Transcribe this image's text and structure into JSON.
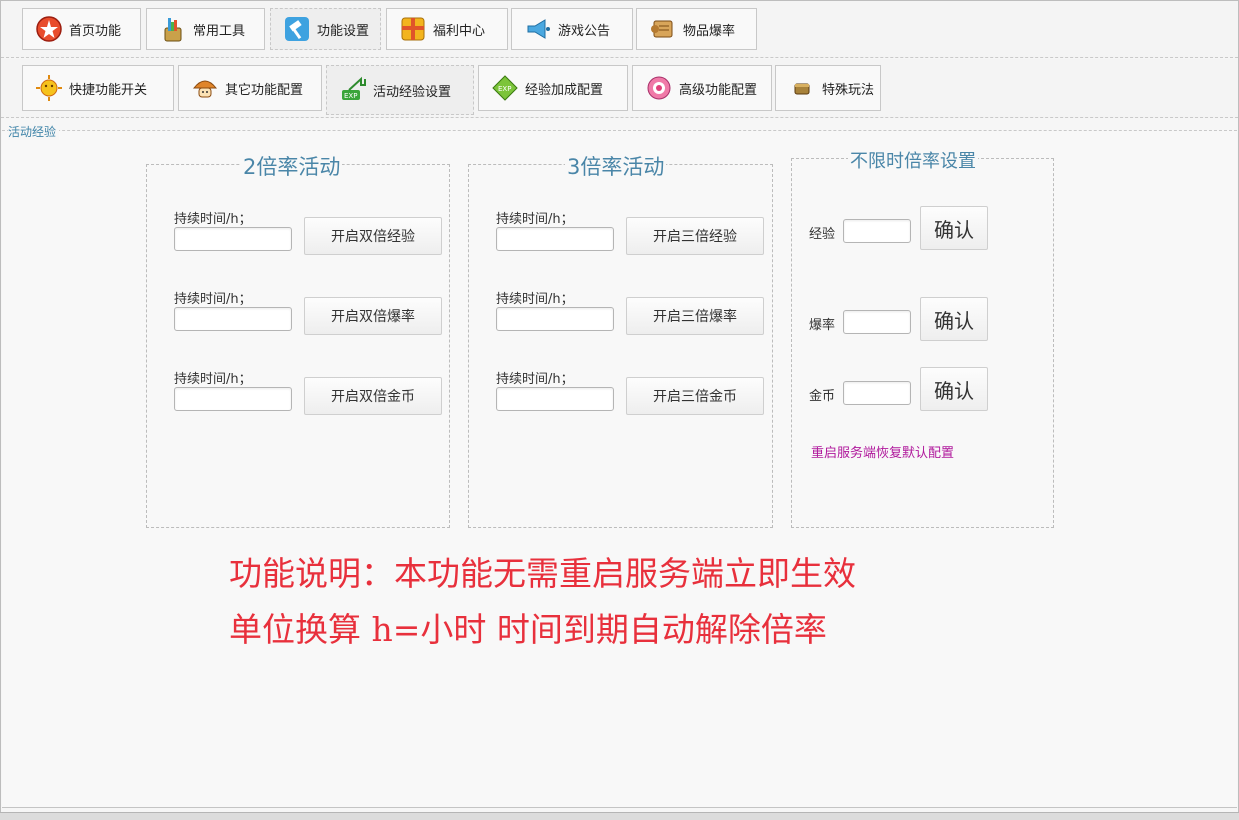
{
  "top_tabs": [
    {
      "label": "首页功能",
      "icon": "red-star-icon"
    },
    {
      "label": "常用工具",
      "icon": "tools-icon"
    },
    {
      "label": "功能设置",
      "icon": "hammer-icon"
    },
    {
      "label": "福利中心",
      "icon": "gift-box-icon"
    },
    {
      "label": "游戏公告",
      "icon": "megaphone-icon"
    },
    {
      "label": "物品爆率",
      "icon": "scroll-icon"
    }
  ],
  "sub_tabs": [
    {
      "label": "快捷功能开关",
      "icon": "sun-icon"
    },
    {
      "label": "其它功能配置",
      "icon": "mushroom-icon"
    },
    {
      "label": "活动经验设置",
      "icon": "exp-arrow-icon"
    },
    {
      "label": "经验加成配置",
      "icon": "exp-diamond-icon"
    },
    {
      "label": "高级功能配置",
      "icon": "pink-badge-icon"
    },
    {
      "label": "特殊玩法",
      "icon": "treasure-icon"
    }
  ],
  "section_title": "活动经验",
  "panel_double": {
    "title": "2倍率活动",
    "rows": [
      {
        "label": "持续时间/h；",
        "input_value": "",
        "button": "开启双倍经验"
      },
      {
        "label": "持续时间/h；",
        "input_value": "",
        "button": "开启双倍爆率"
      },
      {
        "label": "持续时间/h；",
        "input_value": "",
        "button": "开启双倍金币"
      }
    ]
  },
  "panel_triple": {
    "title": "3倍率活动",
    "rows": [
      {
        "label": "持续时间/h；",
        "input_value": "",
        "button": "开启三倍经验"
      },
      {
        "label": "持续时间/h；",
        "input_value": "",
        "button": "开启三倍爆率"
      },
      {
        "label": "持续时间/h；",
        "input_value": "",
        "button": "开启三倍金币"
      }
    ]
  },
  "panel_unlimited": {
    "title": "不限时倍率设置",
    "rows": [
      {
        "label": "经验",
        "input_value": "",
        "button": "确认"
      },
      {
        "label": "爆率",
        "input_value": "",
        "button": "确认"
      },
      {
        "label": "金币",
        "input_value": "",
        "button": "确认"
      }
    ],
    "reset_note": "重启服务端恢复默认配置"
  },
  "notes": [
    "功能说明：本功能无需重启服务端立即生效",
    "单位换算 h=小时 时间到期自动解除倍率"
  ],
  "colors": {
    "panel_title": "#4a86a8",
    "note_red": "#e8303c",
    "reset_purple": "#b0189c"
  }
}
